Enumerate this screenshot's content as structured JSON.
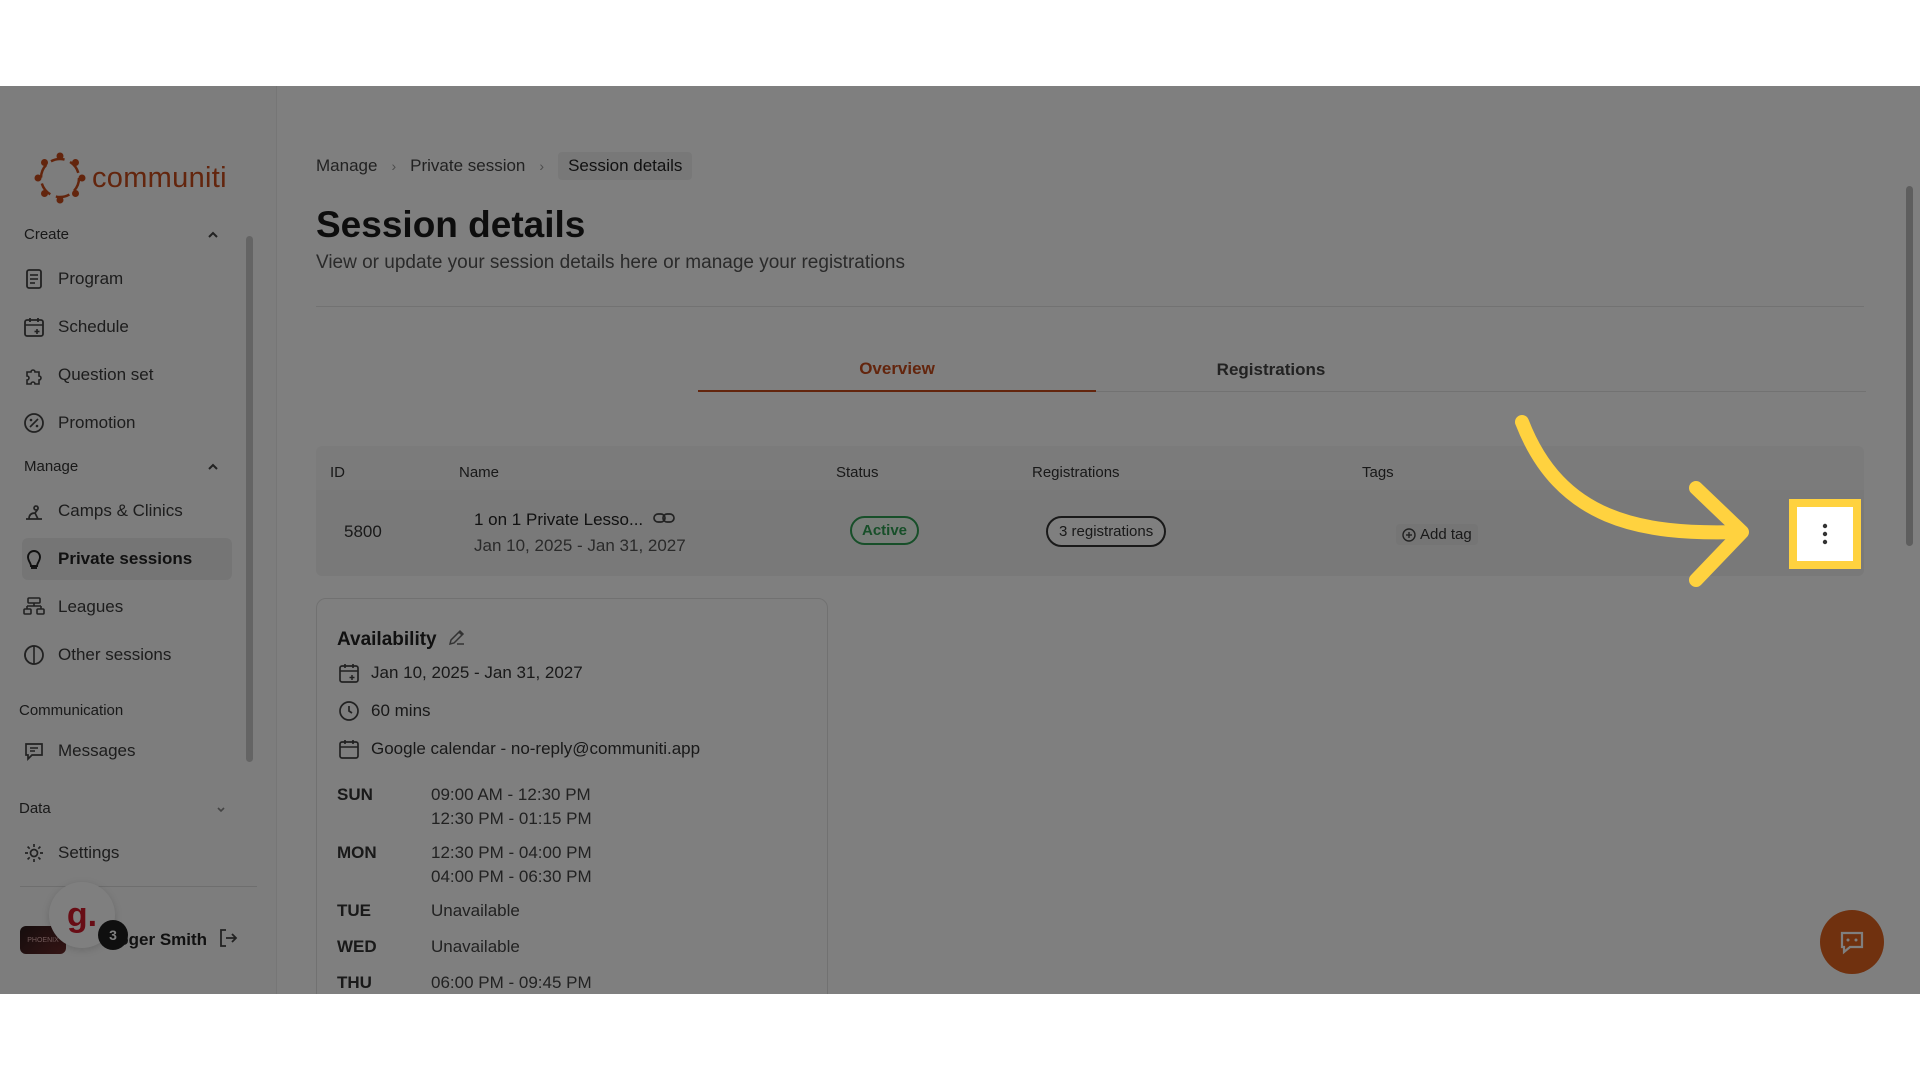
{
  "brand": {
    "name": "communiti",
    "color": "#c74a1a"
  },
  "sidebar": {
    "create_label": "Create",
    "create_items": [
      {
        "label": "Program",
        "icon": "document-icon"
      },
      {
        "label": "Schedule",
        "icon": "calendar-plus-icon"
      },
      {
        "label": "Question set",
        "icon": "puzzle-icon"
      },
      {
        "label": "Promotion",
        "icon": "percent-badge-icon"
      }
    ],
    "manage_label": "Manage",
    "manage_items": [
      {
        "label": "Camps & Clinics",
        "icon": "run-icon"
      },
      {
        "label": "Private sessions",
        "icon": "whistle-icon",
        "active": true
      },
      {
        "label": "Leagues",
        "icon": "bracket-icon"
      },
      {
        "label": "Other sessions",
        "icon": "half-circle-icon"
      }
    ],
    "communication_label": "Communication",
    "messages_label": "Messages",
    "data_label": "Data",
    "settings_label": "Settings",
    "user": {
      "avatar_text": "PHOENIX",
      "name": "Roger Smith"
    },
    "g_widget": {
      "letter": "g.",
      "badge": "3"
    }
  },
  "breadcrumb": [
    "Manage",
    "Private session",
    "Session details"
  ],
  "page": {
    "title": "Session details",
    "subtitle": "View or update your session details here or manage your registrations"
  },
  "tabs": [
    "Overview",
    "Registrations"
  ],
  "table": {
    "headers": [
      "ID",
      "Name",
      "Status",
      "Registrations",
      "Tags"
    ],
    "row": {
      "id": "5800",
      "name": "1 on 1 Private Lesso...",
      "dates": "Jan 10, 2025 - Jan 31, 2027",
      "status": "Active",
      "registrations": "3 registrations",
      "add_tag": "Add tag"
    }
  },
  "availability": {
    "title": "Availability",
    "dates": "Jan 10, 2025 - Jan 31, 2027",
    "duration": "60 mins",
    "calendar": "Google calendar - no-reply@communiti.app",
    "schedule": [
      {
        "day": "SUN",
        "slots": [
          "09:00 AM - 12:30 PM",
          "12:30 PM - 01:15 PM"
        ]
      },
      {
        "day": "MON",
        "slots": [
          "12:30 PM - 04:00 PM",
          "04:00 PM - 06:30 PM"
        ]
      },
      {
        "day": "TUE",
        "slots": [
          "Unavailable"
        ]
      },
      {
        "day": "WED",
        "slots": [
          "Unavailable"
        ]
      },
      {
        "day": "THU",
        "slots": [
          "06:00 PM - 09:45 PM"
        ]
      }
    ]
  },
  "colors": {
    "accent": "#c74a1a",
    "active_green": "#2e9e52",
    "highlight": "#ffd23f",
    "chat_fab": "#e0621e"
  }
}
